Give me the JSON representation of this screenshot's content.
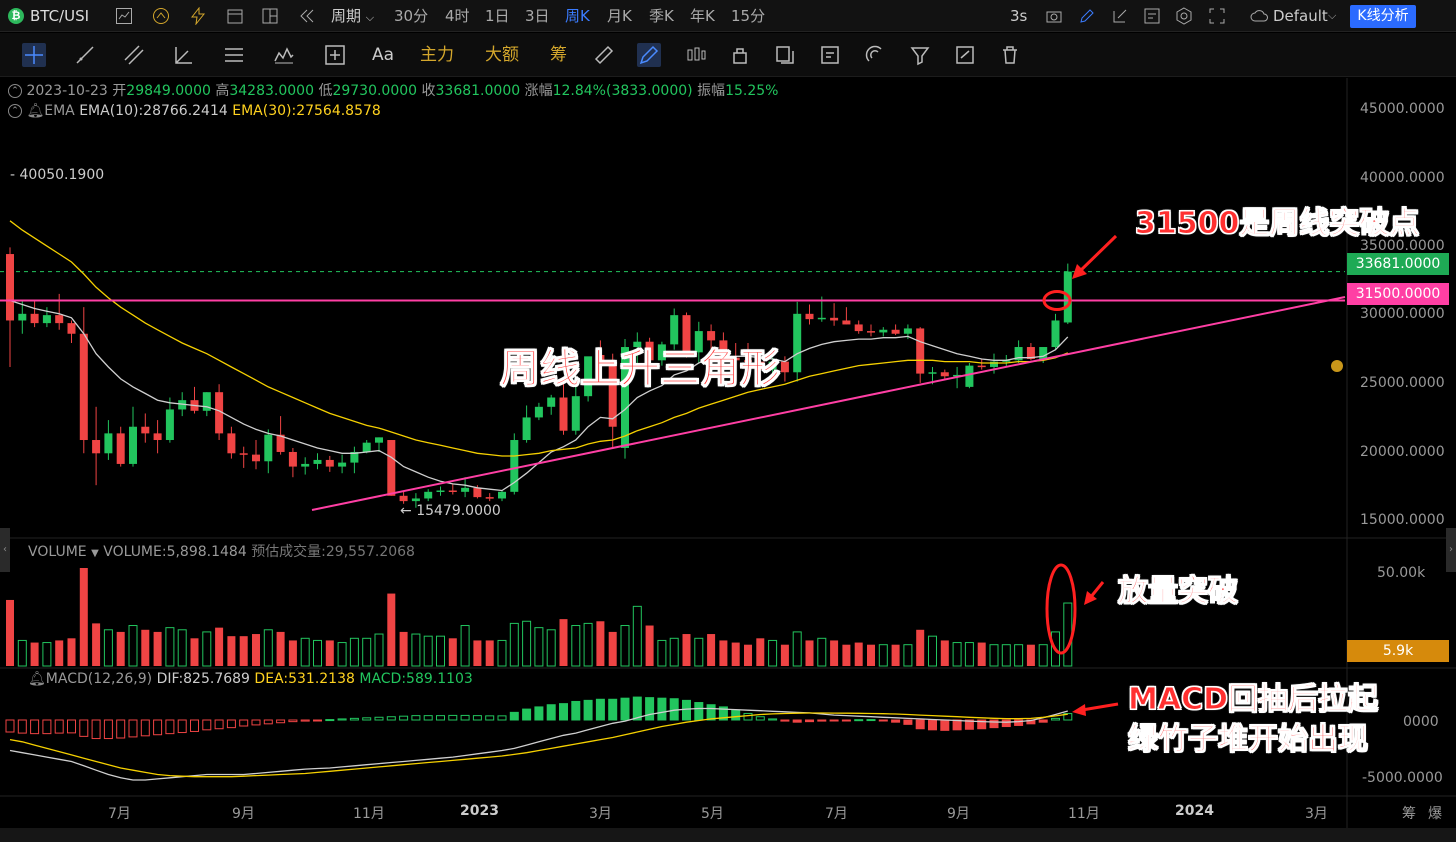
{
  "topbar": {
    "symbol": "BTC/USI",
    "symbol_icon": "bitcoin-icon",
    "period_label": "周期",
    "intervals": [
      "30分",
      "4时",
      "1日",
      "3日",
      "周K",
      "月K",
      "季K",
      "年K",
      "15分"
    ],
    "active_interval": "周K",
    "refresh": "3s",
    "theme": "Default",
    "analysis_button": "K线分析"
  },
  "drawbar": {
    "tools_text": [
      "Aa",
      "主力",
      "大额",
      "筹"
    ]
  },
  "ohlc": {
    "date": "2023-10-23",
    "open_label": "开",
    "open": "29849.0000",
    "high_label": "高",
    "high": "34283.0000",
    "low_label": "低",
    "low": "29730.0000",
    "close_label": "收",
    "close": "33681.0000",
    "change_label": "涨幅",
    "change": "12.84%(3833.0000)",
    "amp_label": "振幅",
    "amp": "15.25%"
  },
  "ema": {
    "name": "EMA",
    "ema10": "EMA(10):28766.2414",
    "ema30": "EMA(30):27564.8578"
  },
  "volume_info": {
    "name": "VOLUME",
    "value": "VOLUME:5,898.1484",
    "estimate": "预估成交量:29,557.2068"
  },
  "macd_info": {
    "name": "MACD(12,26,9)",
    "dif": "DIF:825.7689",
    "dea": "DEA:531.2138",
    "macd": "MACD:589.1103"
  },
  "price_axis": [
    "45000.0000",
    "40000.0000",
    "35000.0000",
    "30000.0000",
    "25000.0000",
    "20000.0000",
    "15000.0000"
  ],
  "volume_axis": [
    "50.00k"
  ],
  "macd_axis": [
    "0000",
    "-5000.0000"
  ],
  "time_axis": [
    "7月",
    "9月",
    "11月",
    "2023",
    "3月",
    "5月",
    "7月",
    "9月",
    "11月",
    "2024",
    "3月"
  ],
  "bottom_right": [
    "筹",
    "爆"
  ],
  "markers": {
    "high_label": "40050.1900",
    "low_label": "15479.0000",
    "current_price": "33681.0000",
    "breakout_price": "31500.0000",
    "volume_tag": "5.9k"
  },
  "annotations": {
    "breakout": "31500是周线突破点",
    "triangle": "周线上升三角形",
    "volume": "放量突破",
    "macd_line1": "MACD回抽后拉起",
    "macd_line2": "绿竹子堆开始出现"
  },
  "colors": {
    "up": "#22c55e",
    "down": "#ef4444",
    "ema10": "#cfcfcf",
    "ema30": "#f5d000",
    "trendline": "#ff3fa4",
    "accent": "#2b6bff"
  },
  "chart_data": {
    "type": "candlestick",
    "period": "weekly",
    "price_range": [
      14000,
      47500
    ],
    "candles": [
      {
        "o": 35000,
        "h": 35500,
        "l": 26500,
        "c": 30000
      },
      {
        "o": 30000,
        "h": 31500,
        "l": 29000,
        "c": 30500
      },
      {
        "o": 30500,
        "h": 31500,
        "l": 29500,
        "c": 29800
      },
      {
        "o": 29800,
        "h": 31000,
        "l": 29500,
        "c": 30400
      },
      {
        "o": 30400,
        "h": 32000,
        "l": 29300,
        "c": 29800
      },
      {
        "o": 29800,
        "h": 30000,
        "l": 28300,
        "c": 29000
      },
      {
        "o": 29000,
        "h": 31000,
        "l": 20000,
        "c": 21000
      },
      {
        "o": 21000,
        "h": 23500,
        "l": 17600,
        "c": 20000
      },
      {
        "o": 20000,
        "h": 22500,
        "l": 19500,
        "c": 21500
      },
      {
        "o": 21500,
        "h": 22000,
        "l": 19000,
        "c": 19200
      },
      {
        "o": 19200,
        "h": 23500,
        "l": 19000,
        "c": 22000
      },
      {
        "o": 22000,
        "h": 23000,
        "l": 20800,
        "c": 21500
      },
      {
        "o": 21500,
        "h": 22500,
        "l": 20000,
        "c": 21000
      },
      {
        "o": 21000,
        "h": 24200,
        "l": 20800,
        "c": 23300
      },
      {
        "o": 23300,
        "h": 24600,
        "l": 22800,
        "c": 24000
      },
      {
        "o": 24000,
        "h": 25000,
        "l": 23000,
        "c": 23200
      },
      {
        "o": 23200,
        "h": 24600,
        "l": 22800,
        "c": 24600
      },
      {
        "o": 24600,
        "h": 25200,
        "l": 21000,
        "c": 21500
      },
      {
        "o": 21500,
        "h": 22000,
        "l": 19600,
        "c": 20000
      },
      {
        "o": 20000,
        "h": 20500,
        "l": 18900,
        "c": 19900
      },
      {
        "o": 19900,
        "h": 21000,
        "l": 18800,
        "c": 19400
      },
      {
        "o": 19400,
        "h": 21800,
        "l": 18500,
        "c": 21400
      },
      {
        "o": 21400,
        "h": 22800,
        "l": 19900,
        "c": 20100
      },
      {
        "o": 20100,
        "h": 20400,
        "l": 18200,
        "c": 19000
      },
      {
        "o": 19000,
        "h": 19700,
        "l": 18400,
        "c": 19200
      },
      {
        "o": 19200,
        "h": 20000,
        "l": 18800,
        "c": 19500
      },
      {
        "o": 19500,
        "h": 19800,
        "l": 18600,
        "c": 19000
      },
      {
        "o": 19000,
        "h": 19900,
        "l": 18500,
        "c": 19300
      },
      {
        "o": 19300,
        "h": 20500,
        "l": 18500,
        "c": 20100
      },
      {
        "o": 20100,
        "h": 21000,
        "l": 20000,
        "c": 20800
      },
      {
        "o": 20800,
        "h": 21200,
        "l": 20100,
        "c": 21200
      },
      {
        "o": 21000,
        "h": 21000,
        "l": 16800,
        "c": 16800
      },
      {
        "o": 16800,
        "h": 17200,
        "l": 16200,
        "c": 16400
      },
      {
        "o": 16400,
        "h": 17000,
        "l": 15900,
        "c": 16600
      },
      {
        "o": 16600,
        "h": 17300,
        "l": 16400,
        "c": 17100
      },
      {
        "o": 17100,
        "h": 17500,
        "l": 16800,
        "c": 17200
      },
      {
        "o": 17200,
        "h": 17700,
        "l": 16900,
        "c": 17100
      },
      {
        "o": 17100,
        "h": 18200,
        "l": 16700,
        "c": 17400
      },
      {
        "o": 17400,
        "h": 17600,
        "l": 16600,
        "c": 16700
      },
      {
        "o": 16700,
        "h": 17000,
        "l": 16400,
        "c": 16600
      },
      {
        "o": 16600,
        "h": 17200,
        "l": 16400,
        "c": 17100
      },
      {
        "o": 17100,
        "h": 21500,
        "l": 16900,
        "c": 21000
      },
      {
        "o": 21000,
        "h": 23600,
        "l": 20800,
        "c": 22700
      },
      {
        "o": 22700,
        "h": 23800,
        "l": 22500,
        "c": 23500
      },
      {
        "o": 23500,
        "h": 24400,
        "l": 22900,
        "c": 24200
      },
      {
        "o": 24200,
        "h": 25200,
        "l": 21400,
        "c": 21700
      },
      {
        "o": 21700,
        "h": 25000,
        "l": 21400,
        "c": 24300
      },
      {
        "o": 24300,
        "h": 25300,
        "l": 23900,
        "c": 27300
      },
      {
        "o": 27400,
        "h": 28500,
        "l": 26800,
        "c": 26900
      },
      {
        "o": 26900,
        "h": 27500,
        "l": 20400,
        "c": 22000
      },
      {
        "o": 20400,
        "h": 28600,
        "l": 19600,
        "c": 28000
      },
      {
        "o": 28000,
        "h": 29100,
        "l": 26700,
        "c": 28400
      },
      {
        "o": 28400,
        "h": 28700,
        "l": 26500,
        "c": 27000
      },
      {
        "o": 27000,
        "h": 28400,
        "l": 26600,
        "c": 28200
      },
      {
        "o": 28200,
        "h": 30900,
        "l": 27800,
        "c": 30400
      },
      {
        "o": 30400,
        "h": 30600,
        "l": 27200,
        "c": 27600
      },
      {
        "o": 27600,
        "h": 29900,
        "l": 26800,
        "c": 29200
      },
      {
        "o": 29200,
        "h": 29700,
        "l": 27000,
        "c": 28500
      },
      {
        "o": 28500,
        "h": 29100,
        "l": 27000,
        "c": 27200
      },
      {
        "o": 27200,
        "h": 28300,
        "l": 26800,
        "c": 27000
      },
      {
        "o": 27000,
        "h": 28300,
        "l": 26200,
        "c": 26900
      },
      {
        "o": 26900,
        "h": 27600,
        "l": 25300,
        "c": 26300
      },
      {
        "o": 26300,
        "h": 27200,
        "l": 25600,
        "c": 26900
      },
      {
        "o": 26900,
        "h": 27300,
        "l": 25400,
        "c": 26100
      },
      {
        "o": 26100,
        "h": 31400,
        "l": 25400,
        "c": 30500
      },
      {
        "o": 30500,
        "h": 31200,
        "l": 29700,
        "c": 30100
      },
      {
        "o": 30100,
        "h": 31800,
        "l": 29900,
        "c": 30200
      },
      {
        "o": 30200,
        "h": 31300,
        "l": 29600,
        "c": 30000
      },
      {
        "o": 30000,
        "h": 31000,
        "l": 29700,
        "c": 29700
      },
      {
        "o": 29700,
        "h": 30000,
        "l": 29000,
        "c": 29200
      },
      {
        "o": 29200,
        "h": 29700,
        "l": 28800,
        "c": 29100
      },
      {
        "o": 29100,
        "h": 29500,
        "l": 28800,
        "c": 29300
      },
      {
        "o": 29300,
        "h": 29700,
        "l": 28900,
        "c": 29000
      },
      {
        "o": 29000,
        "h": 29700,
        "l": 28600,
        "c": 29400
      },
      {
        "o": 29400,
        "h": 29500,
        "l": 25300,
        "c": 26000
      },
      {
        "o": 26000,
        "h": 26500,
        "l": 25200,
        "c": 26100
      },
      {
        "o": 26100,
        "h": 26300,
        "l": 25600,
        "c": 25800
      },
      {
        "o": 25800,
        "h": 26500,
        "l": 24900,
        "c": 25900
      },
      {
        "o": 25000,
        "h": 26800,
        "l": 24900,
        "c": 26600
      },
      {
        "o": 26600,
        "h": 27100,
        "l": 26300,
        "c": 26500
      },
      {
        "o": 26500,
        "h": 27500,
        "l": 26000,
        "c": 26900
      },
      {
        "o": 26900,
        "h": 27400,
        "l": 26500,
        "c": 27000
      },
      {
        "o": 27000,
        "h": 28500,
        "l": 26800,
        "c": 28000
      },
      {
        "o": 28000,
        "h": 28300,
        "l": 27000,
        "c": 27100
      },
      {
        "o": 27100,
        "h": 28000,
        "l": 26800,
        "c": 28000
      },
      {
        "o": 28000,
        "h": 30500,
        "l": 27800,
        "c": 30000
      },
      {
        "o": 29849,
        "h": 34283,
        "l": 29730,
        "c": 33681
      }
    ],
    "ema10": [
      31500,
      31200,
      30900,
      30700,
      30500,
      30200,
      29000,
      27500,
      26500,
      25600,
      25000,
      24500,
      24000,
      23800,
      23700,
      23600,
      23500,
      23200,
      22700,
      22200,
      21800,
      21500,
      21300,
      21000,
      20700,
      20400,
      20200,
      20000,
      20000,
      20100,
      20200,
      19700,
      19000,
      18600,
      18200,
      17900,
      17700,
      17600,
      17400,
      17300,
      17200,
      17800,
      18500,
      19300,
      20100,
      20500,
      21000,
      22000,
      22700,
      22600,
      23300,
      24200,
      24700,
      25100,
      25900,
      26200,
      26800,
      27200,
      27300,
      27300,
      27300,
      27200,
      27100,
      26900,
      27500,
      27900,
      28200,
      28400,
      28500,
      28600,
      28600,
      28700,
      28700,
      28800,
      28400,
      28100,
      27800,
      27500,
      27300,
      27100,
      27000,
      27000,
      27200,
      27200,
      27300,
      27800,
      28766
    ],
    "ema30": [
      37500,
      36800,
      36200,
      35600,
      35000,
      34400,
      33500,
      32500,
      31700,
      31000,
      30400,
      29800,
      29300,
      28800,
      28300,
      27900,
      27500,
      27000,
      26500,
      26000,
      25500,
      25000,
      24600,
      24200,
      23800,
      23400,
      23000,
      22700,
      22400,
      22100,
      21900,
      21600,
      21300,
      21000,
      20800,
      20600,
      20400,
      20200,
      20000,
      19900,
      19800,
      19800,
      19900,
      20000,
      20200,
      20300,
      20400,
      20700,
      20900,
      21000,
      21300,
      21700,
      22000,
      22300,
      22700,
      23000,
      23400,
      23700,
      24000,
      24300,
      24600,
      24800,
      25000,
      25200,
      25500,
      25800,
      26000,
      26200,
      26400,
      26600,
      26700,
      26800,
      26900,
      27000,
      27000,
      27000,
      26900,
      26900,
      26900,
      26800,
      26800,
      26800,
      26900,
      26900,
      27000,
      27200,
      27565
    ],
    "volume": [
      31000,
      12000,
      11000,
      11000,
      12000,
      13000,
      46000,
      20000,
      17000,
      16000,
      19000,
      17000,
      16000,
      18000,
      17000,
      13000,
      16000,
      18000,
      14000,
      14000,
      15000,
      17000,
      16000,
      12000,
      13000,
      12000,
      12000,
      11000,
      13000,
      13000,
      15000,
      34000,
      16000,
      15000,
      14000,
      14000,
      13000,
      19000,
      12000,
      12000,
      12000,
      20000,
      21000,
      18000,
      17000,
      22000,
      19000,
      20000,
      21000,
      16000,
      19000,
      28000,
      19000,
      12000,
      13000,
      15000,
      13000,
      15000,
      12000,
      11000,
      10000,
      13000,
      12000,
      10000,
      16000,
      12000,
      13000,
      12000,
      10000,
      11000,
      10000,
      10000,
      10000,
      10000,
      17000,
      14000,
      12000,
      11000,
      11000,
      11000,
      10000,
      10000,
      10000,
      10000,
      10000,
      16000,
      29557
    ],
    "macd_hist": [
      -1100,
      -1200,
      -1250,
      -1250,
      -1200,
      -1180,
      -1500,
      -1700,
      -1700,
      -1650,
      -1550,
      -1450,
      -1350,
      -1250,
      -1150,
      -1050,
      -900,
      -800,
      -700,
      -550,
      -450,
      -350,
      -250,
      -150,
      -100,
      -50,
      40,
      100,
      150,
      200,
      250,
      300,
      350,
      400,
      400,
      400,
      420,
      420,
      400,
      380,
      380,
      700,
      1000,
      1200,
      1400,
      1500,
      1700,
      1800,
      1900,
      1900,
      2000,
      2100,
      2050,
      2000,
      1950,
      1800,
      1600,
      1400,
      1200,
      900,
      600,
      300,
      100,
      -100,
      -200,
      -150,
      -100,
      -50,
      -20,
      30,
      40,
      -50,
      -200,
      -400,
      -800,
      -900,
      -950,
      -900,
      -850,
      -800,
      -700,
      -600,
      -500,
      -350,
      -200,
      150,
      589
    ],
    "macd_dif": [
      -2800,
      -3000,
      -3200,
      -3400,
      -3600,
      -3800,
      -4200,
      -4600,
      -5000,
      -5300,
      -5500,
      -5500,
      -5400,
      -5300,
      -5200,
      -5100,
      -5000,
      -5000,
      -5000,
      -5000,
      -4900,
      -4800,
      -4700,
      -4600,
      -4500,
      -4450,
      -4400,
      -4300,
      -4200,
      -4100,
      -4000,
      -3900,
      -3800,
      -3700,
      -3600,
      -3500,
      -3400,
      -3250,
      -3100,
      -2950,
      -2800,
      -2600,
      -2300,
      -2000,
      -1700,
      -1400,
      -1200,
      -900,
      -600,
      -300,
      -100,
      200,
      500,
      700,
      900,
      1000,
      1050,
      1050,
      1000,
      950,
      900,
      850,
      800,
      750,
      700,
      650,
      550,
      450,
      400,
      350,
      300,
      250,
      200,
      150,
      100,
      50,
      0,
      -50,
      -100,
      -150,
      -180,
      -200,
      -150,
      -50,
      200,
      500,
      826
    ],
    "macd_dea": [
      -1800,
      -2000,
      -2300,
      -2600,
      -2900,
      -3200,
      -3500,
      -3800,
      -4100,
      -4400,
      -4600,
      -4800,
      -5000,
      -5100,
      -5150,
      -5200,
      -5200,
      -5200,
      -5200,
      -5150,
      -5100,
      -5050,
      -5000,
      -4950,
      -4900,
      -4800,
      -4700,
      -4600,
      -4500,
      -4400,
      -4300,
      -4200,
      -4100,
      -4000,
      -3900,
      -3800,
      -3700,
      -3600,
      -3500,
      -3400,
      -3300,
      -3150,
      -3000,
      -2800,
      -2600,
      -2400,
      -2200,
      -2000,
      -1800,
      -1600,
      -1350,
      -1100,
      -850,
      -600,
      -400,
      -200,
      -50,
      100,
      200,
      300,
      400,
      500,
      560,
      600,
      620,
      640,
      640,
      630,
      620,
      610,
      600,
      580,
      550,
      500,
      450,
      400,
      350,
      300,
      250,
      200,
      160,
      130,
      120,
      150,
      250,
      380,
      531
    ]
  }
}
